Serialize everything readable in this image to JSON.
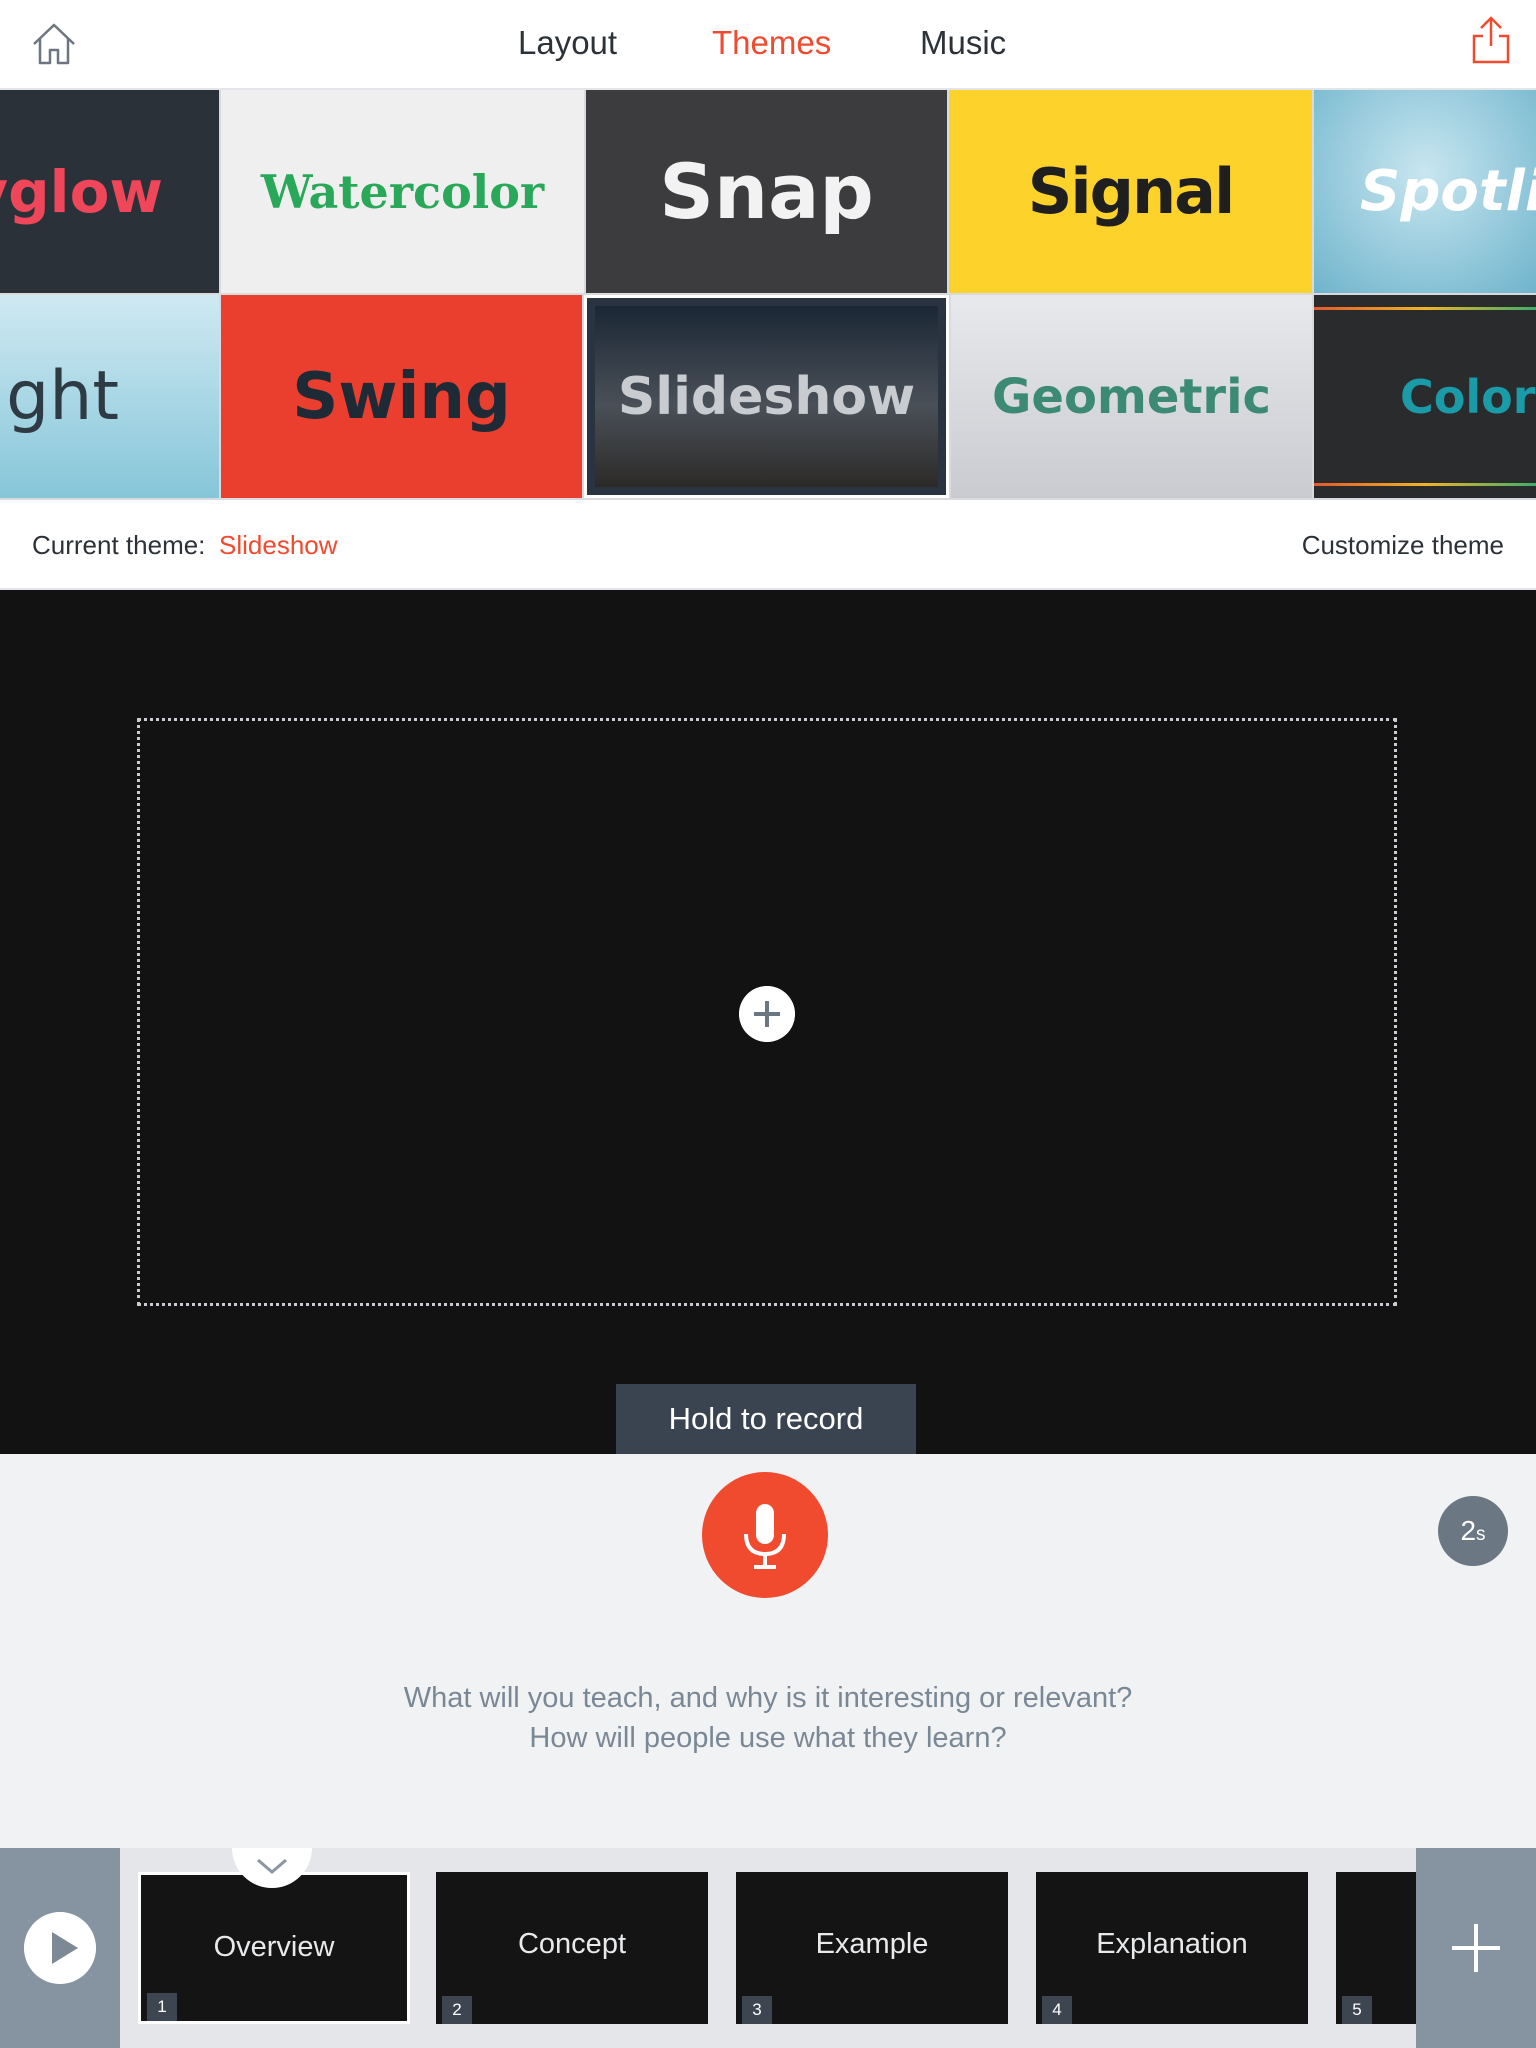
{
  "nav": {
    "tabs": [
      {
        "label": "Layout"
      },
      {
        "label": "Themes"
      },
      {
        "label": "Music"
      }
    ],
    "active_tab": "Themes"
  },
  "themes": {
    "tiles": [
      {
        "label": "yglow"
      },
      {
        "label": "Watercolor"
      },
      {
        "label": "Snap"
      },
      {
        "label": "Signal"
      },
      {
        "label": "Spotli"
      },
      {
        "label": "light"
      },
      {
        "label": "Swing"
      },
      {
        "label": "Slideshow"
      },
      {
        "label": "Geometric"
      },
      {
        "label": "Color"
      }
    ]
  },
  "theme_bar": {
    "current_label": "Current theme:",
    "current_value": "Slideshow",
    "customize_label": "Customize theme"
  },
  "stage": {
    "tooltip": "Hold to record"
  },
  "record": {
    "timer_value": "2",
    "timer_unit": "s",
    "prompt_line1": "What will you teach, and why is it interesting or relevant?",
    "prompt_line2": "How will people use what they learn?"
  },
  "filmstrip": {
    "slides": [
      {
        "label": "Overview",
        "number": "1"
      },
      {
        "label": "Concept",
        "number": "2"
      },
      {
        "label": "Example",
        "number": "3"
      },
      {
        "label": "Explanation",
        "number": "4"
      },
      {
        "label": "",
        "number": "5"
      }
    ]
  },
  "colors": {
    "accent": "#f04a2f",
    "stage_bg": "#121213",
    "panel_bg": "#f1f2f4",
    "rail_bg": "#8693a0"
  }
}
